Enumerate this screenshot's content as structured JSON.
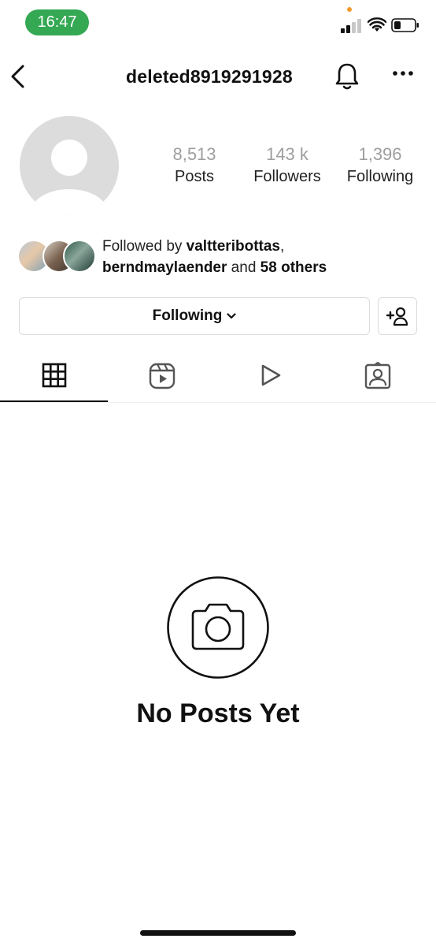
{
  "status_bar": {
    "time": "16:47"
  },
  "header": {
    "username": "deleted8919291928"
  },
  "profile": {
    "stats": [
      {
        "value": "8,513",
        "label": "Posts"
      },
      {
        "value": "143 k",
        "label": "Followers"
      },
      {
        "value": "1,396",
        "label": "Following"
      }
    ],
    "followed_by": {
      "prefix": "Followed by ",
      "user1": "valtteribottas",
      "separator": ",",
      "user2": "berndmaylaender",
      "connector": " and ",
      "others": "58 others"
    }
  },
  "actions": {
    "following_label": "Following"
  },
  "tabs": [
    {
      "icon": "grid-icon",
      "selected": true
    },
    {
      "icon": "reels-icon",
      "selected": false
    },
    {
      "icon": "video-play-icon",
      "selected": false
    },
    {
      "icon": "tagged-icon",
      "selected": false
    }
  ],
  "empty_state": {
    "title": "No Posts Yet",
    "icon": "camera-icon"
  },
  "colors": {
    "time_pill": "#34a853",
    "stat_number": "#9e9e9e",
    "border": "#dbdbdb"
  }
}
